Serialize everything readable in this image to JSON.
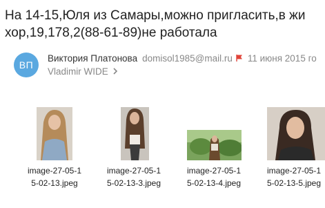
{
  "message": {
    "subject_line1": "На 14-15,Юля из Самары,можно пригласить,в жи",
    "subject_line2": "хор,19,178,2(88-61-89)не работала",
    "avatar_initials": "ВП",
    "sender_name": "Виктория Платонова",
    "sender_email": "domisol1985@mail.ru",
    "date": "11 июня 2015 го",
    "recipient": "Vladimir WIDE"
  },
  "attachments": [
    {
      "name_line1": "image-27-05-1",
      "name_line2": "5-02-13.jpeg"
    },
    {
      "name_line1": "image-27-05-1",
      "name_line2": "5-02-13-3.jpeg"
    },
    {
      "name_line1": "image-27-05-1",
      "name_line2": "5-02-13-4.jpeg"
    },
    {
      "name_line1": "image-27-05-1",
      "name_line2": "5-02-13-5.jpeg"
    }
  ],
  "colors": {
    "avatar_bg": "#5aa8e0",
    "text_primary": "#222222",
    "text_secondary": "#888888",
    "flag": "#e0443a"
  },
  "icons": {
    "flag": "flag-icon",
    "chevron": "chevron-right-icon"
  }
}
